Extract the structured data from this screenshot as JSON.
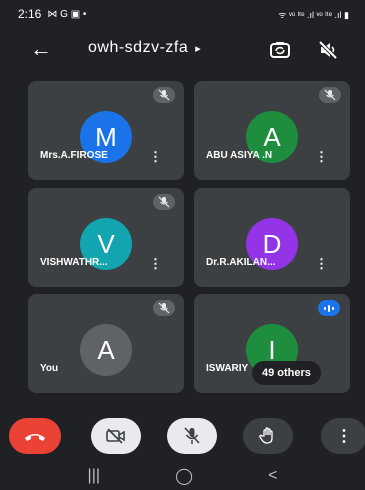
{
  "status_bar": {
    "time": "2:16",
    "notif_icons": "⋈ G ▣ •",
    "right_text": "ᯤ ᵛᵒ ˡᵗᵉ .ıl ᵛᵒ ˡᵗᵉ .ıl ▮"
  },
  "header": {
    "meeting_code": "owh-sdzv-zfa",
    "caret": "▸"
  },
  "participants": [
    {
      "name": "Mrs.A.FIROSE",
      "initial": "M",
      "color": "#1a73e8"
    },
    {
      "name": "ABU ASIYA .N",
      "initial": "A",
      "color": "#1e8e3e"
    },
    {
      "name": "VISHWATHR...",
      "initial": "V",
      "color": "#12a4af"
    },
    {
      "name": "Dr.R.AKILAN...",
      "initial": "D",
      "color": "#9334e6"
    },
    {
      "name": "You",
      "initial": "A",
      "color": "#5f6368"
    },
    {
      "name": "ISWARIY",
      "initial": "I",
      "color": "#1e8e3e"
    }
  ],
  "others_pill": "49 others",
  "menu_glyph": "⋮",
  "nav": {
    "recents": "|||",
    "home": "◯",
    "back": "<"
  }
}
